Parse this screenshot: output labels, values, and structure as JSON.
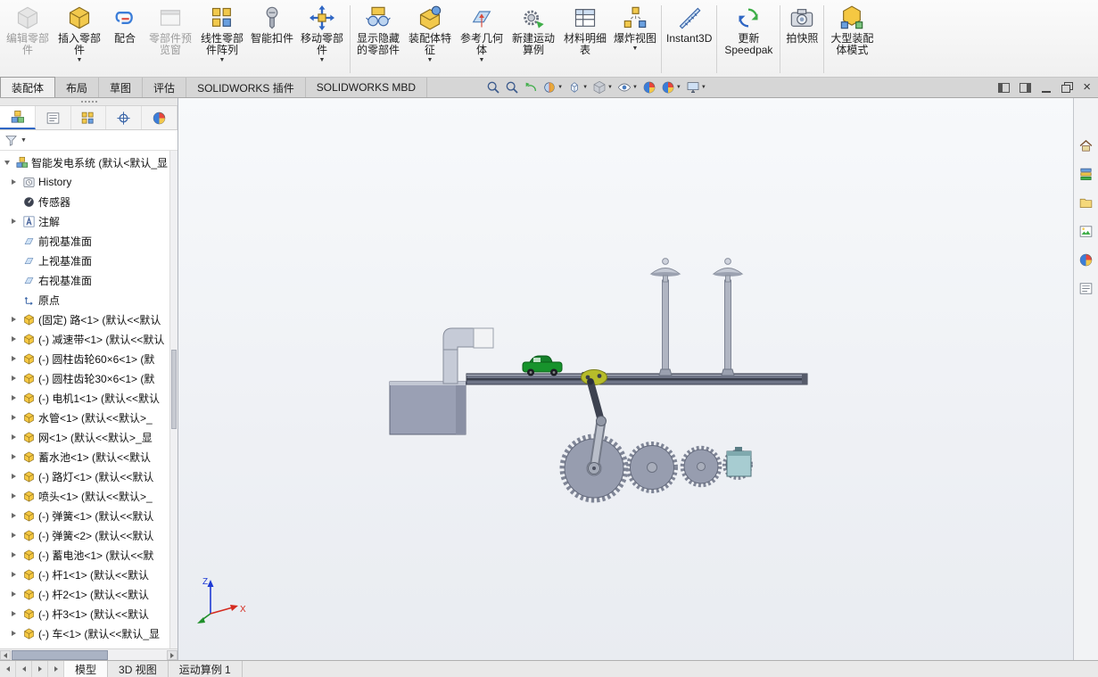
{
  "ui": {
    "caret_down": "▼",
    "close_glyph": "×"
  },
  "ribbon": {
    "buttons": [
      {
        "label": "编辑零部件",
        "enabled": false
      },
      {
        "label": "插入零部件",
        "enabled": true,
        "dropdown": true
      },
      {
        "label": "配合",
        "enabled": true
      },
      {
        "label": "零部件预览窗",
        "enabled": false
      },
      {
        "label": "线性零部件阵列",
        "enabled": true,
        "dropdown": true
      },
      {
        "label": "智能扣件",
        "enabled": true
      },
      {
        "label": "移动零部件",
        "enabled": true,
        "dropdown": true
      },
      {
        "label": "显示隐藏的零部件",
        "enabled": true
      },
      {
        "label": "装配体特征",
        "enabled": true,
        "dropdown": true
      },
      {
        "label": "参考几何体",
        "enabled": true,
        "dropdown": true
      },
      {
        "label": "新建运动算例",
        "enabled": true
      },
      {
        "label": "材料明细表",
        "enabled": true
      },
      {
        "label": "爆炸视图",
        "enabled": true,
        "dropdown": true
      },
      {
        "label": "Instant3D",
        "enabled": true
      },
      {
        "label": "更新 Speedpak",
        "enabled": true
      },
      {
        "label": "拍快照",
        "enabled": true
      },
      {
        "label": "大型装配体模式",
        "enabled": true
      }
    ]
  },
  "command_tabs": {
    "items": [
      {
        "label": "装配体",
        "active": true
      },
      {
        "label": "布局",
        "active": false
      },
      {
        "label": "草图",
        "active": false
      },
      {
        "label": "评估",
        "active": false
      },
      {
        "label": "SOLIDWORKS 插件",
        "active": false
      },
      {
        "label": "SOLIDWORKS MBD",
        "active": false
      }
    ]
  },
  "hud": {
    "icons": [
      "zoom-fit",
      "zoom-to-area",
      "previous-view",
      "section-view",
      "view-orientation",
      "display-style",
      "hide-show-items",
      "edit-appearance",
      "apply-scene",
      "view-settings"
    ]
  },
  "feature_tree": {
    "root": {
      "label": "智能发电系统 (默认<默认_显"
    },
    "items": [
      {
        "label": "History"
      },
      {
        "label": "传感器"
      },
      {
        "label": "注解"
      },
      {
        "label": "前视基准面"
      },
      {
        "label": "上视基准面"
      },
      {
        "label": "右视基准面"
      },
      {
        "label": "原点"
      },
      {
        "label": "(固定) 路<1> (默认<<默认"
      },
      {
        "label": "(-) 减速带<1> (默认<<默认"
      },
      {
        "label": "(-) 圆柱齿轮60×6<1> (默"
      },
      {
        "label": "(-) 圆柱齿轮30×6<1> (默"
      },
      {
        "label": "(-) 电机1<1> (默认<<默认"
      },
      {
        "label": "水管<1> (默认<<默认>_"
      },
      {
        "label": "网<1> (默认<<默认>_显"
      },
      {
        "label": "蓄水池<1> (默认<<默认"
      },
      {
        "label": "(-) 路灯<1> (默认<<默认"
      },
      {
        "label": "喷头<1> (默认<<默认>_"
      },
      {
        "label": "(-) 弹簧<1> (默认<<默认"
      },
      {
        "label": "(-) 弹簧<2> (默认<<默认"
      },
      {
        "label": "(-) 蓄电池<1> (默认<<默"
      },
      {
        "label": "(-) 杆1<1> (默认<<默认"
      },
      {
        "label": "(-) 杆2<1> (默认<<默认"
      },
      {
        "label": "(-) 杆3<1> (默认<<默认"
      },
      {
        "label": "(-) 车<1> (默认<<默认_显"
      }
    ]
  },
  "task_pane": {
    "icons": [
      "home",
      "design-library",
      "file-explorer",
      "view-palette",
      "appearances",
      "custom-properties"
    ]
  },
  "status_bar": {
    "tabs": [
      {
        "label": "模型",
        "active": true
      },
      {
        "label": "3D 视图",
        "active": false
      },
      {
        "label": "运动算例 1",
        "active": false
      }
    ]
  },
  "viewport": {
    "triad": {
      "x_label": "X",
      "z_label": "Z"
    }
  },
  "colors": {
    "accent_blue": "#2f66c4",
    "part_yellow": "#f2c94c",
    "gear_gray": "#979daf",
    "viewport_bg": "#f1f3f7"
  }
}
